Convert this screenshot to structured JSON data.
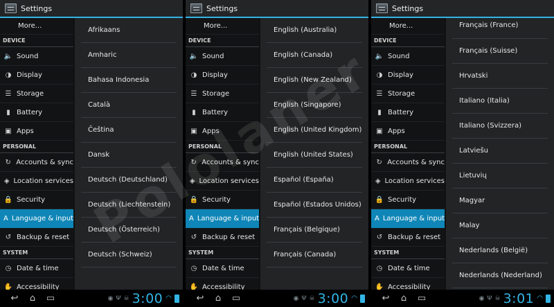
{
  "watermark": "Pololaner",
  "screens": [
    {
      "title": "Settings",
      "clock": "3:00",
      "items": [
        {
          "kind": "item",
          "label": "More...",
          "icon": "",
          "selected": false,
          "more": true
        },
        {
          "kind": "header",
          "label": "DEVICE"
        },
        {
          "kind": "item",
          "label": "Sound",
          "icon": "speaker-icon",
          "selected": false
        },
        {
          "kind": "item",
          "label": "Display",
          "icon": "display-icon",
          "selected": false
        },
        {
          "kind": "item",
          "label": "Storage",
          "icon": "storage-icon",
          "selected": false
        },
        {
          "kind": "item",
          "label": "Battery",
          "icon": "battery-icon",
          "selected": false
        },
        {
          "kind": "item",
          "label": "Apps",
          "icon": "apps-icon",
          "selected": false
        },
        {
          "kind": "header",
          "label": "PERSONAL"
        },
        {
          "kind": "item",
          "label": "Accounts & sync",
          "icon": "sync-icon",
          "selected": false
        },
        {
          "kind": "item",
          "label": "Location services",
          "icon": "location-icon",
          "selected": false
        },
        {
          "kind": "item",
          "label": "Security",
          "icon": "lock-icon",
          "selected": false
        },
        {
          "kind": "item",
          "label": "Language & input",
          "icon": "language-icon",
          "selected": true
        },
        {
          "kind": "item",
          "label": "Backup & reset",
          "icon": "backup-icon",
          "selected": false
        },
        {
          "kind": "header",
          "label": "SYSTEM"
        },
        {
          "kind": "item",
          "label": "Date & time",
          "icon": "clock-icon",
          "selected": false
        },
        {
          "kind": "item",
          "label": "Accessibility",
          "icon": "accessibility-icon",
          "selected": false
        }
      ],
      "languages": [
        "Afrikaans",
        "Amharic",
        "Bahasa Indonesia",
        "Català",
        "Čeština",
        "Dansk",
        "Deutsch (Deutschland)",
        "Deutsch (Liechtenstein)",
        "Deutsch (Österreich)",
        "Deutsch (Schweiz)"
      ]
    },
    {
      "title": "Settings",
      "clock": "3:00",
      "items": [
        {
          "kind": "item",
          "label": "More...",
          "icon": "",
          "selected": false,
          "more": true
        },
        {
          "kind": "header",
          "label": "DEVICE"
        },
        {
          "kind": "item",
          "label": "Sound",
          "icon": "speaker-icon",
          "selected": false
        },
        {
          "kind": "item",
          "label": "Display",
          "icon": "display-icon",
          "selected": false
        },
        {
          "kind": "item",
          "label": "Storage",
          "icon": "storage-icon",
          "selected": false
        },
        {
          "kind": "item",
          "label": "Battery",
          "icon": "battery-icon",
          "selected": false
        },
        {
          "kind": "item",
          "label": "Apps",
          "icon": "apps-icon",
          "selected": false
        },
        {
          "kind": "header",
          "label": "PERSONAL"
        },
        {
          "kind": "item",
          "label": "Accounts & sync",
          "icon": "sync-icon",
          "selected": false
        },
        {
          "kind": "item",
          "label": "Location services",
          "icon": "location-icon",
          "selected": false
        },
        {
          "kind": "item",
          "label": "Security",
          "icon": "lock-icon",
          "selected": false
        },
        {
          "kind": "item",
          "label": "Language & input",
          "icon": "language-icon",
          "selected": true
        },
        {
          "kind": "item",
          "label": "Backup & reset",
          "icon": "backup-icon",
          "selected": false
        },
        {
          "kind": "header",
          "label": "SYSTEM"
        },
        {
          "kind": "item",
          "label": "Date & time",
          "icon": "clock-icon",
          "selected": false
        },
        {
          "kind": "item",
          "label": "Accessibility",
          "icon": "accessibility-icon",
          "selected": false
        }
      ],
      "languages": [
        "English (Australia)",
        "English (Canada)",
        "English (New Zealand)",
        "English (Singapore)",
        "English (United Kingdom)",
        "English (United States)",
        "Español (España)",
        "Español (Estados Unidos)",
        "Français (Belgique)",
        "Français (Canada)"
      ]
    },
    {
      "title": "Settings",
      "clock": "3:01",
      "items": [
        {
          "kind": "item",
          "label": "More...",
          "icon": "",
          "selected": false,
          "more": true
        },
        {
          "kind": "header",
          "label": "DEVICE"
        },
        {
          "kind": "item",
          "label": "Sound",
          "icon": "speaker-icon",
          "selected": false
        },
        {
          "kind": "item",
          "label": "Display",
          "icon": "display-icon",
          "selected": false
        },
        {
          "kind": "item",
          "label": "Storage",
          "icon": "storage-icon",
          "selected": false
        },
        {
          "kind": "item",
          "label": "Battery",
          "icon": "battery-icon",
          "selected": false
        },
        {
          "kind": "item",
          "label": "Apps",
          "icon": "apps-icon",
          "selected": false
        },
        {
          "kind": "header",
          "label": "PERSONAL"
        },
        {
          "kind": "item",
          "label": "Accounts & sync",
          "icon": "sync-icon",
          "selected": false
        },
        {
          "kind": "item",
          "label": "Location services",
          "icon": "location-icon",
          "selected": false
        },
        {
          "kind": "item",
          "label": "Security",
          "icon": "lock-icon",
          "selected": false
        },
        {
          "kind": "item",
          "label": "Language & input",
          "icon": "language-icon",
          "selected": true
        },
        {
          "kind": "item",
          "label": "Backup & reset",
          "icon": "backup-icon",
          "selected": false
        },
        {
          "kind": "header",
          "label": "SYSTEM"
        },
        {
          "kind": "item",
          "label": "Date & time",
          "icon": "clock-icon",
          "selected": false
        },
        {
          "kind": "item",
          "label": "Accessibility",
          "icon": "accessibility-icon",
          "selected": false
        }
      ],
      "languages": [
        "Français (France)",
        "Français (Suisse)",
        "Hrvatski",
        "Italiano (Italia)",
        "Italiano (Svizzera)",
        "Latviešu",
        "Lietuvių",
        "Magyar",
        "Malay",
        "Nederlands (België)",
        "Nederlands (Nederland)"
      ]
    }
  ],
  "navbar": {
    "buttons": [
      "back-icon",
      "home-icon",
      "recent-apps-icon"
    ],
    "status_icons": [
      "wifi-icon",
      "battery-status-icon"
    ],
    "accent": "#33b5e5"
  }
}
